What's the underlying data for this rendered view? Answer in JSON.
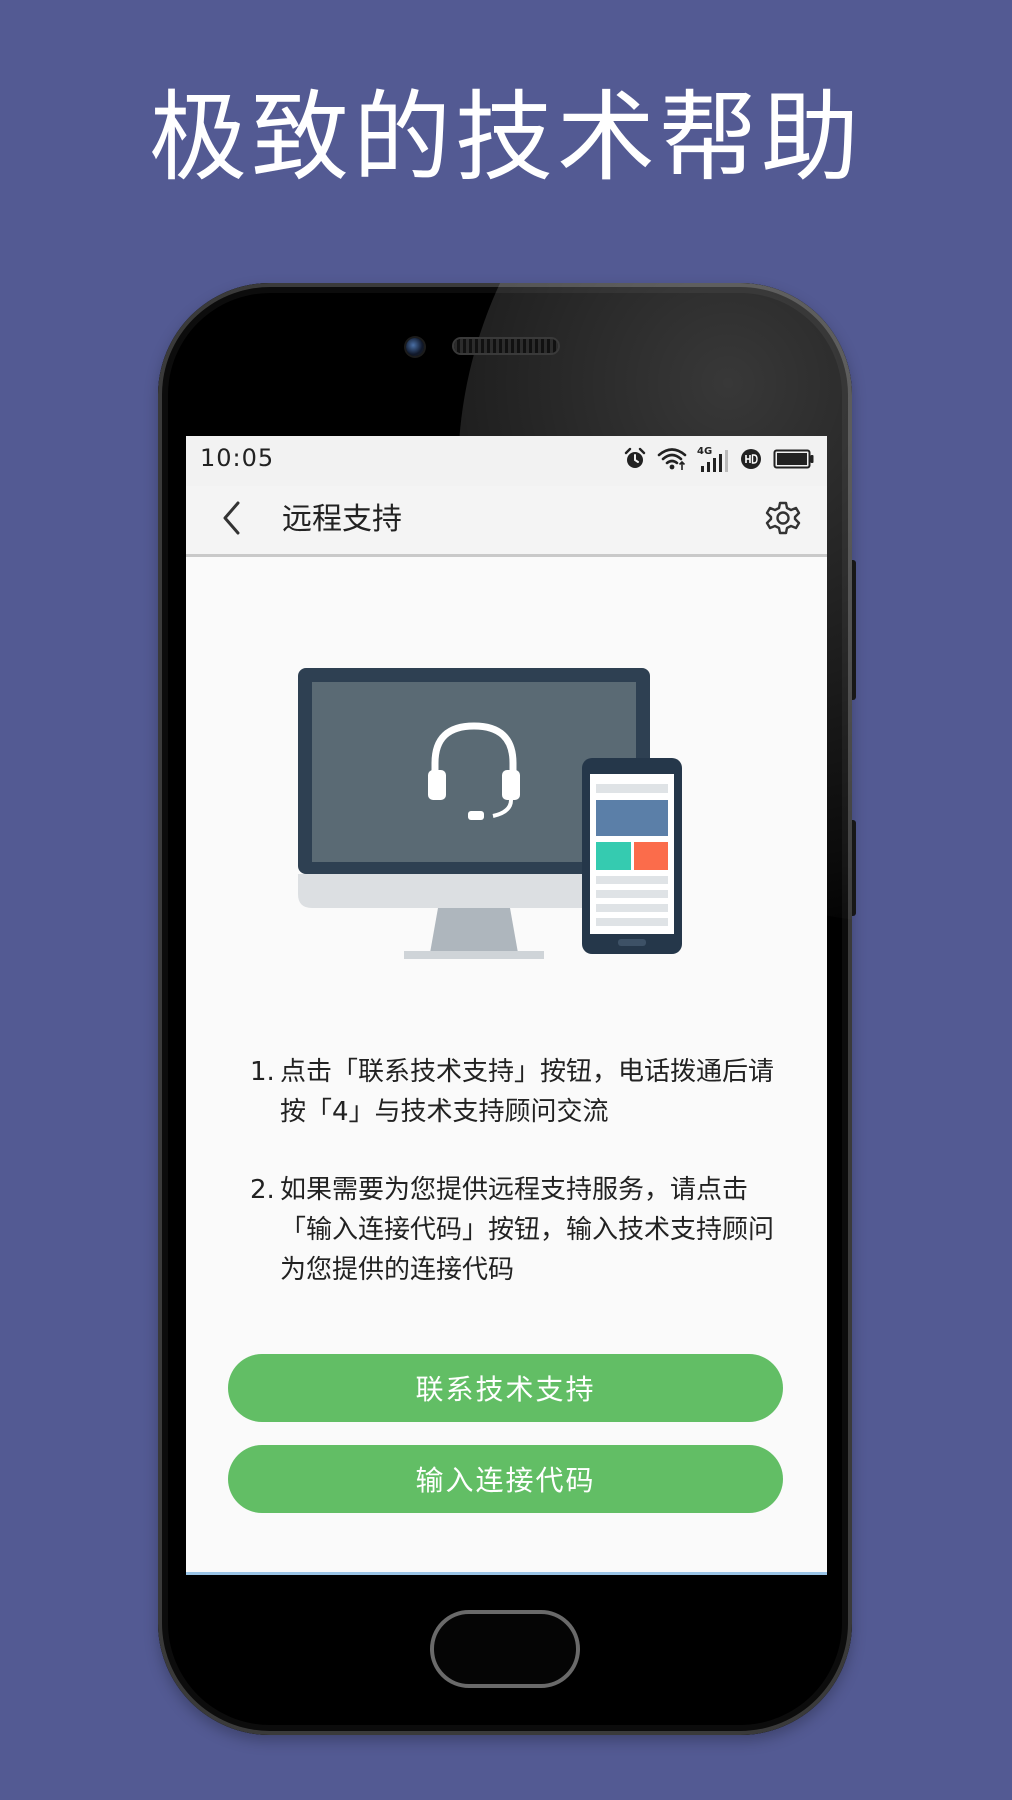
{
  "promo": {
    "headline": "极致的技术帮助"
  },
  "statusbar": {
    "time": "10:05",
    "network_label": "4G",
    "icons": [
      "alarm-icon",
      "wifi-icon",
      "signal-icon",
      "hd-icon",
      "battery-icon"
    ]
  },
  "appbar": {
    "title": "远程支持",
    "back_icon": "chevron-left-icon",
    "settings_icon": "gear-icon"
  },
  "illustration": {
    "icons": [
      "monitor-icon",
      "headset-icon",
      "smartphone-icon"
    ]
  },
  "instructions": [
    {
      "number": "1.",
      "text": "点击「联系技术支持」按钮，电话拨通后请按「4」与技术支持顾问交流"
    },
    {
      "number": "2.",
      "text": "如果需要为您提供远程支持服务，请点击「输入连接代码」按钮，输入技术支持顾问为您提供的连接代码"
    }
  ],
  "buttons": {
    "contact_support": "联系技术支持",
    "enter_code": "输入连接代码"
  },
  "colors": {
    "background": "#535a93",
    "primary_button": "#62be65",
    "screen_background": "#fafafa",
    "monitor_frame": "#2e4052",
    "monitor_screen": "#5a6a74",
    "tile_blue": "#5b7fa8",
    "tile_teal": "#35cbb0",
    "tile_orange": "#fb6c4b"
  }
}
